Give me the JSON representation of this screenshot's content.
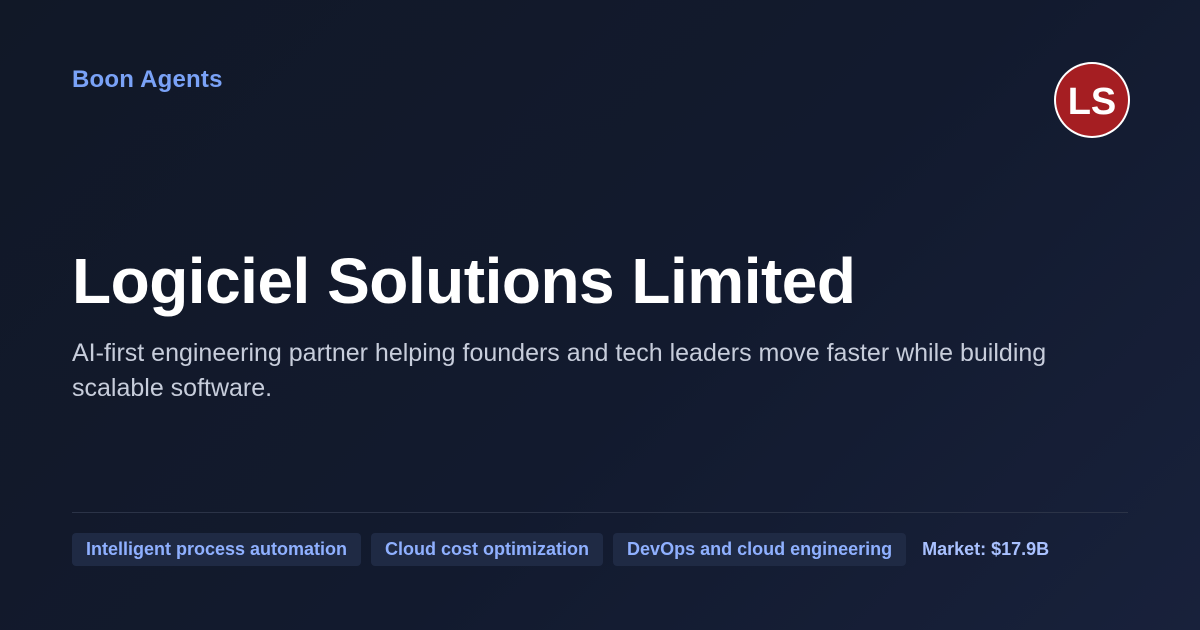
{
  "brand": {
    "name": "Boon Agents"
  },
  "logo": {
    "icon": "ls-monogram-icon",
    "text": "LS",
    "color": "#a51e22"
  },
  "company": {
    "name": "Logiciel Solutions Limited",
    "tagline": "AI-first engineering partner helping founders and tech leaders move faster while building scalable software."
  },
  "tags": [
    {
      "label": "Intelligent process automation"
    },
    {
      "label": "Cloud cost optimization"
    },
    {
      "label": "DevOps and cloud engineering"
    }
  ],
  "market": {
    "label": "Market: $17.9B"
  },
  "colors": {
    "background": "#111827",
    "accent": "#7aa2f7",
    "tag_background": "#1f2a44",
    "tag_text": "#8fb0ff"
  }
}
